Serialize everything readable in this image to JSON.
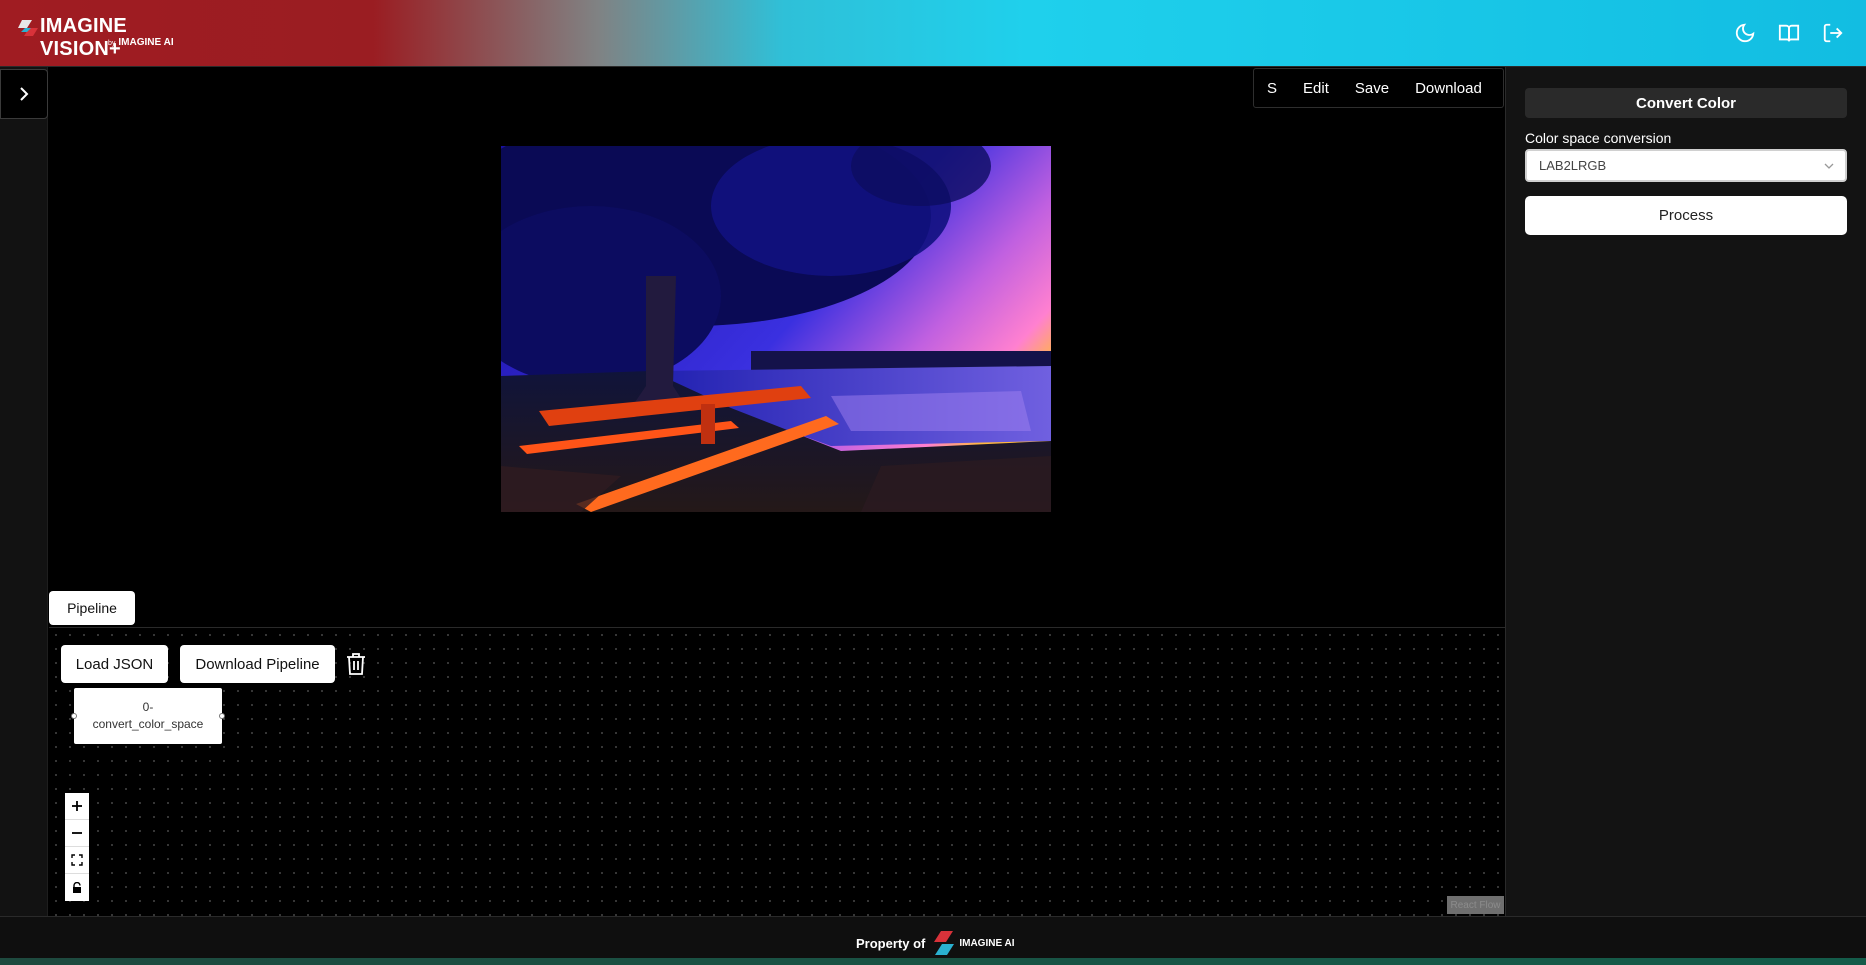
{
  "header": {
    "brand_name": "IMAGINE VISION+",
    "brand_by": "by",
    "brand_company": "IMAGINE AI",
    "icons": [
      "moon-icon",
      "book-icon",
      "logout-icon"
    ]
  },
  "toolbar": {
    "s_label": "S",
    "edit_label": "Edit",
    "save_label": "Save",
    "download_label": "Download"
  },
  "pipeline": {
    "tab_label": "Pipeline",
    "load_json_label": "Load JSON",
    "download_pipeline_label": "Download Pipeline",
    "node_label_line1": "0-",
    "node_label_line2": "convert_color_space",
    "zoom_controls": [
      "plus-icon",
      "minus-icon",
      "fit-view-icon",
      "lock-icon"
    ],
    "attribution": "React Flow"
  },
  "right_panel": {
    "title": "Convert Color",
    "field_label": "Color space conversion",
    "selected_option": "LAB2LRGB",
    "process_label": "Process"
  },
  "footer": {
    "property_of": "Property of",
    "company": "IMAGINE AI"
  },
  "colors": {
    "header_red": "#a01c22",
    "header_cyan": "#1fd0ec",
    "panel_bg": "#131313"
  }
}
